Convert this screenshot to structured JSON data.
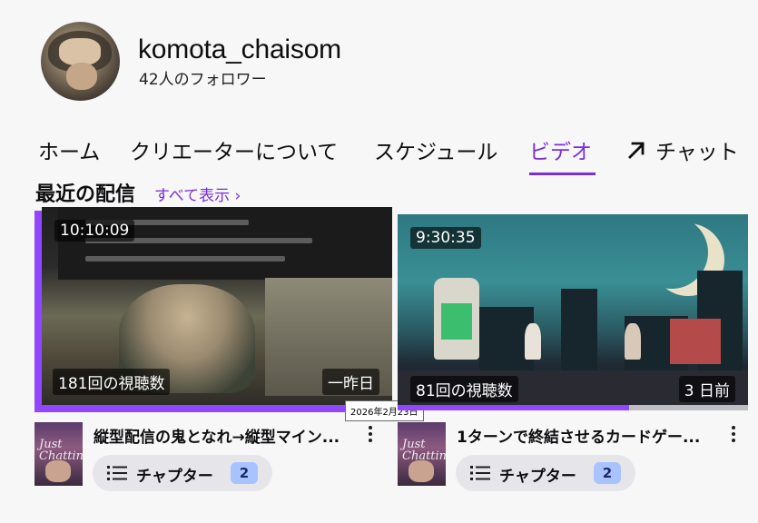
{
  "channel": {
    "name": "komota_chaisom",
    "followers": "42人のフォロワー"
  },
  "tabs": [
    {
      "label": "ホーム",
      "active": false
    },
    {
      "label": "クリエーターについて",
      "active": false
    },
    {
      "label": "スケジュール",
      "active": false
    },
    {
      "label": "ビデオ",
      "active": true
    },
    {
      "label": "チャット",
      "active": false,
      "icon": "external-arrow-icon"
    }
  ],
  "section": {
    "title": "最近の配信",
    "show_all": "すべて表示 ›"
  },
  "videos": [
    {
      "duration": "10:10:09",
      "views": "181回の視聴数",
      "age": "一昨日",
      "title": "縦型配信の鬼となれ→縦型マイン...",
      "chapters_label": "チャプター",
      "chapters_count": "2",
      "watch_progress": 0.0,
      "tooltip": "2026年2月23日"
    },
    {
      "duration": "9:30:35",
      "views": "81回の視聴数",
      "age": "3 日前",
      "title": "1ターンで終結させるカードゲー...",
      "chapters_label": "チャプター",
      "chapters_count": "2",
      "watch_progress": 0.66
    }
  ],
  "colors": {
    "accent": "#9147ff",
    "active_tab": "#7b2fd9",
    "background": "#f7f7f8"
  }
}
